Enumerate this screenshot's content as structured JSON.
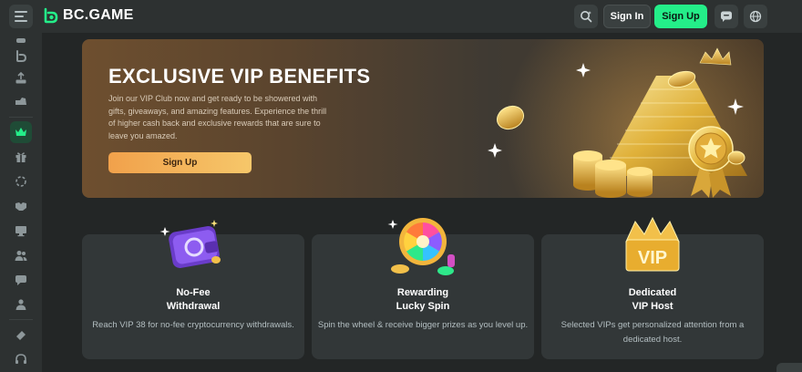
{
  "brand": {
    "name": "BC.GAME",
    "accent": "#24ee89"
  },
  "header": {
    "signin_label": "Sign In",
    "signup_label": "Sign Up"
  },
  "hero": {
    "title": "EXCLUSIVE VIP BENEFITS",
    "description": "Join our VIP Club now and get ready to be showered with gifts, giveaways, and amazing features. Experience the thrill of higher cash back and exclusive rewards that are sure to leave you amazed.",
    "button_label": "Sign Up"
  },
  "cards": [
    {
      "title_line1": "No-Fee",
      "title_line2": "Withdrawal",
      "description": "Reach VIP 38 for no-fee cryptocurrency withdrawals."
    },
    {
      "title_line1": "Rewarding",
      "title_line2": "Lucky Spin",
      "description": "Spin the wheel & receive bigger prizes as you level up."
    },
    {
      "title_line1": "Dedicated",
      "title_line2": "VIP Host",
      "description": "Selected VIPs get personalized attention from a dedicated host.",
      "badge_text": "VIP"
    }
  ]
}
